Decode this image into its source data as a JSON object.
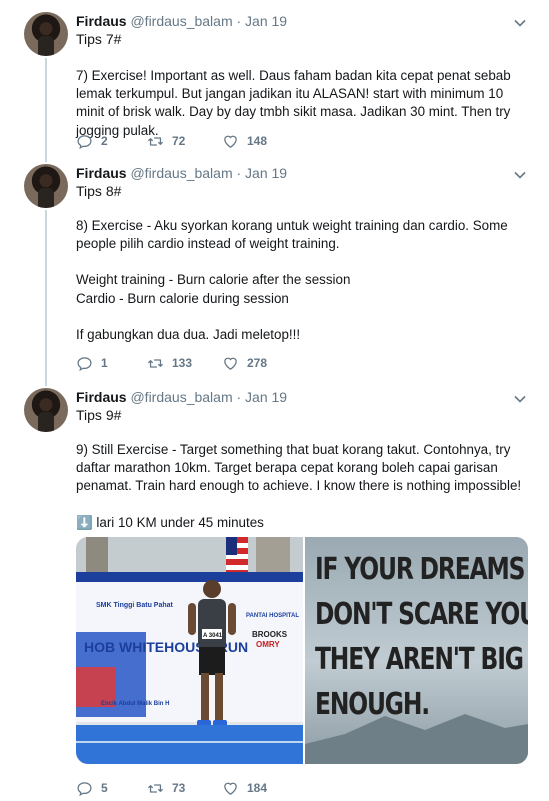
{
  "tweets": [
    {
      "name": "Firdaus",
      "handle": "@firdaus_balam · Jan 19",
      "tip": "Tips 7#",
      "body": [
        "7) Exercise! Important as well. Daus faham badan kita cepat penat sebab lemak terkumpul. But jangan jadikan itu ALASAN! start with minimum 10 minit of brisk walk. Day by day tmbh sikit masa. Jadikan 30 mint. Then try jogging pulak."
      ],
      "replies": "2",
      "retweets": "72",
      "likes": "148"
    },
    {
      "name": "Firdaus",
      "handle": "@firdaus_balam · Jan 19",
      "tip": "Tips 8#",
      "body": [
        "8) Exercise - Aku syorkan korang untuk weight training dan cardio. Some people pilih cardio instead of weight training.",
        "",
        "Weight training - Burn calorie after the session",
        "Cardio - Burn calorie during session",
        "",
        "If gabungkan dua dua. Jadi meletop!!!"
      ],
      "replies": "1",
      "retweets": "133",
      "likes": "278"
    },
    {
      "name": "Firdaus",
      "handle": "@firdaus_balam · Jan 19",
      "tip": "Tips 9#",
      "body": [
        "9) Still Exercise - Target something that buat korang takut. Contohnya, try daftar marathon 10km. Target berapa cepat korang boleh capai garisan penamat. Train hard enough to achieve. I know there is nothing impossible!",
        "",
        "⬇️ lari 10 KM under 45 minutes"
      ],
      "replies": "5",
      "retweets": "73",
      "likes": "184",
      "media": {
        "left_banner": {
          "school": "SMK Tinggi Batu Pahat",
          "event": "HOB WHITEHOUSE RUN",
          "bib": "A 3041",
          "sponsor": "PANTAI HOSPITAL",
          "brand1": "BROOKS",
          "brand2": "OMRY",
          "organizer": "Encik Abdul Malik Bin H"
        },
        "right_quote": [
          "IF YOUR DREAMS",
          "DON'T SCARE YOU,",
          "THEY AREN'T BIG",
          "ENOUGH."
        ]
      }
    }
  ],
  "icons": {
    "reply": "reply-icon",
    "retweet": "retweet-icon",
    "like": "heart-icon",
    "caret": "chevron-down-icon"
  },
  "colors": {
    "text": "#14171a",
    "muted": "#657786",
    "thread": "#ccd6dd"
  }
}
